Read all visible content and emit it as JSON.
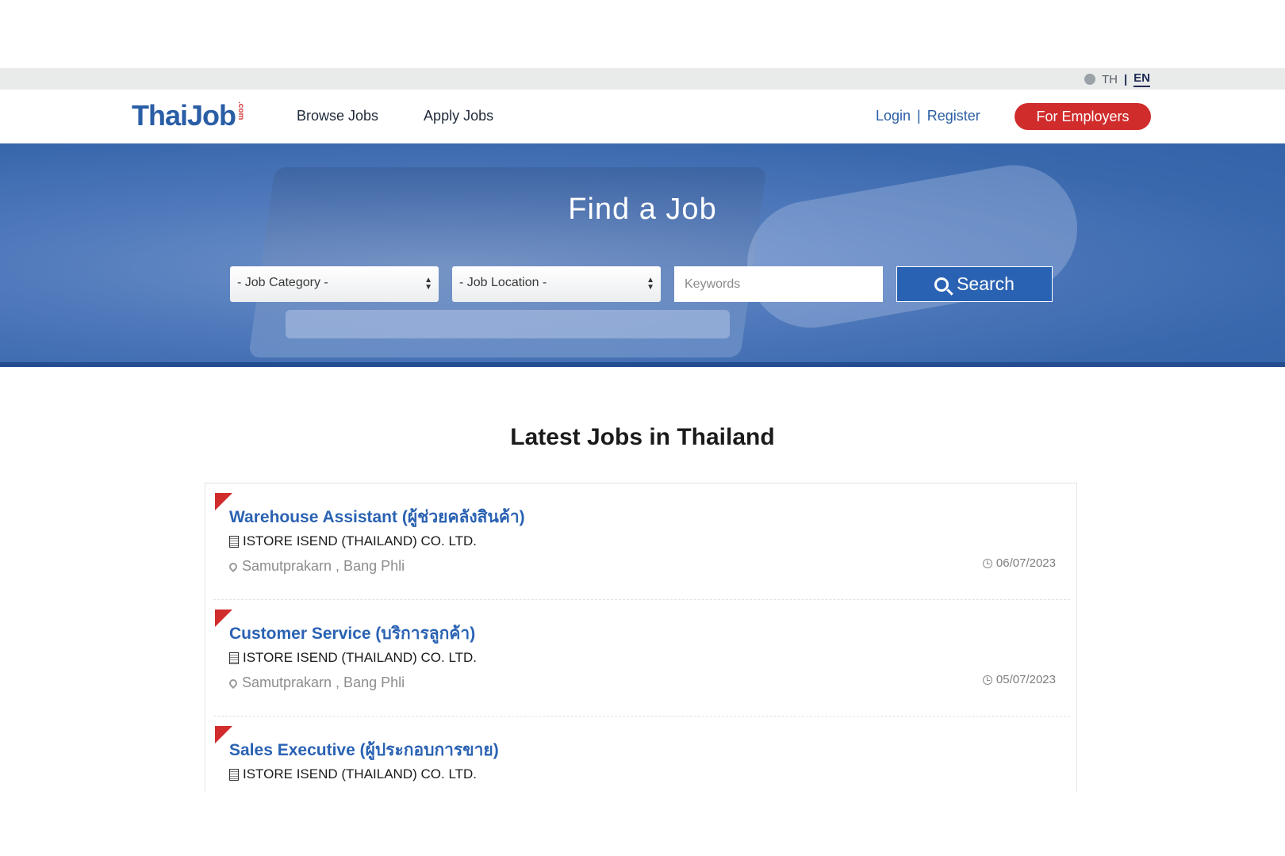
{
  "lang": {
    "th": "TH",
    "separator": "|",
    "en": "EN"
  },
  "header": {
    "logo_text": "ThaiJob",
    "logo_suffix": ".com",
    "nav": [
      "Browse Jobs",
      "Apply Jobs"
    ],
    "login": "Login",
    "auth_separator": "|",
    "register": "Register",
    "employers_button": "For Employers"
  },
  "hero": {
    "title": "Find a Job",
    "category_select": "- Job Category -",
    "location_select": "- Job Location -",
    "keywords_placeholder": "Keywords",
    "search_button": "Search"
  },
  "latest": {
    "title": "Latest Jobs in Thailand",
    "jobs": [
      {
        "title": "Warehouse Assistant (ผู้ช่วยคลังสินค้า)",
        "company": "ISTORE ISEND (THAILAND) CO. LTD.",
        "location": "Samutprakarn , Bang Phli",
        "date": "06/07/2023"
      },
      {
        "title": "Customer Service (บริการลูกค้า)",
        "company": "ISTORE ISEND (THAILAND) CO. LTD.",
        "location": "Samutprakarn , Bang Phli",
        "date": "05/07/2023"
      },
      {
        "title": "Sales Executive (ผู้ประกอบการขาย)",
        "company": "ISTORE ISEND (THAILAND) CO. LTD."
      }
    ]
  },
  "colors": {
    "brand_blue": "#2a5ea6",
    "brand_red": "#d12c2c"
  }
}
